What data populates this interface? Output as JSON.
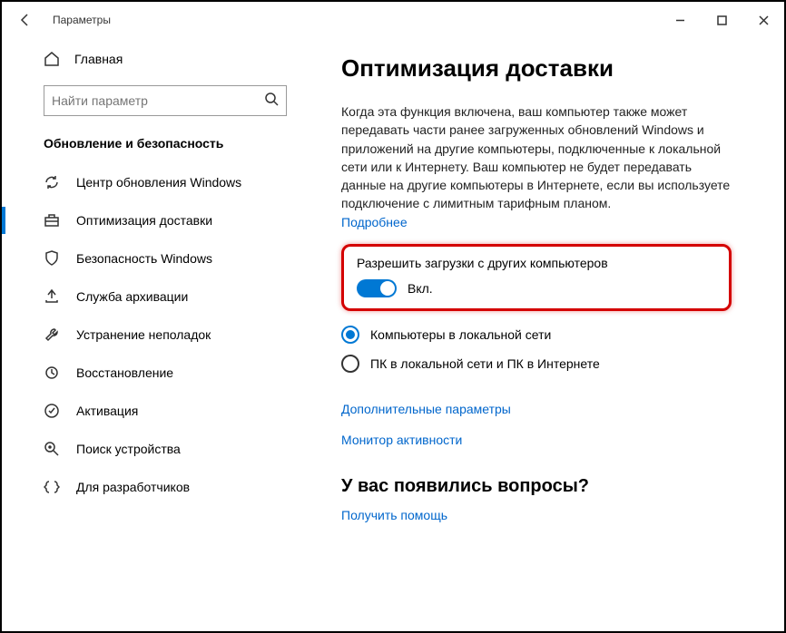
{
  "window": {
    "title": "Параметры"
  },
  "sidebar": {
    "home": "Главная",
    "search_placeholder": "Найти параметр",
    "section": "Обновление и безопасность",
    "items": [
      {
        "label": "Центр обновления Windows"
      },
      {
        "label": "Оптимизация доставки"
      },
      {
        "label": "Безопасность Windows"
      },
      {
        "label": "Служба архивации"
      },
      {
        "label": "Устранение неполадок"
      },
      {
        "label": "Восстановление"
      },
      {
        "label": "Активация"
      },
      {
        "label": "Поиск устройства"
      },
      {
        "label": "Для разработчиков"
      }
    ]
  },
  "main": {
    "title": "Оптимизация доставки",
    "description": "Когда эта функция включена, ваш компьютер также может передавать части ранее загруженных обновлений Windows и приложений на другие компьютеры, подключенные к локальной сети или к Интернету. Ваш компьютер не будет передавать данные на другие компьютеры в Интернете, если вы используете подключение с лимитным тарифным планом.",
    "learn_more": "Подробнее",
    "toggle": {
      "label": "Разрешить загрузки с других компьютеров",
      "state": "Вкл.",
      "on": true
    },
    "radios": [
      {
        "label": "Компьютеры в локальной сети",
        "selected": true
      },
      {
        "label": "ПК в локальной сети и ПК в Интернете",
        "selected": false
      }
    ],
    "advanced_link": "Дополнительные параметры",
    "monitor_link": "Монитор активности",
    "help_heading": "У вас появились вопросы?",
    "help_link": "Получить помощь"
  }
}
